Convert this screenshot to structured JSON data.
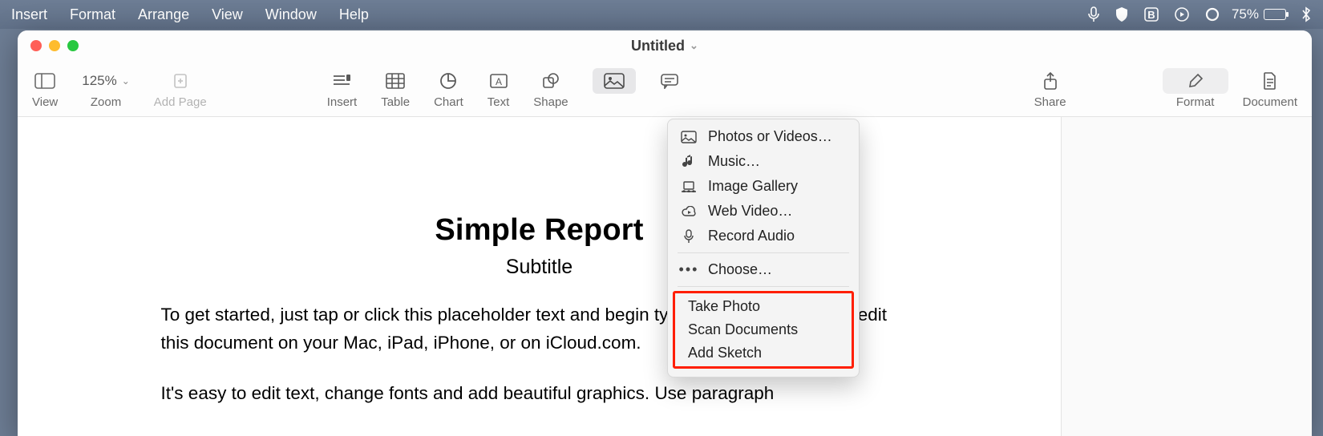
{
  "menubar": {
    "items": [
      "Insert",
      "Format",
      "Arrange",
      "View",
      "Window",
      "Help"
    ],
    "battery": "75%"
  },
  "window": {
    "title": "Untitled"
  },
  "toolbar": {
    "view": "View",
    "zoom_value": "125%",
    "zoom_label": "Zoom",
    "add_page": "Add Page",
    "insert": "Insert",
    "table": "Table",
    "chart": "Chart",
    "text": "Text",
    "shape": "Shape",
    "share": "Share",
    "format": "Format",
    "document": "Document"
  },
  "dropdown": {
    "photos": "Photos or Videos…",
    "music": "Music…",
    "gallery": "Image Gallery",
    "webvideo": "Web Video…",
    "record": "Record Audio",
    "choose": "Choose…",
    "take_photo": "Take Photo",
    "scan_docs": "Scan Documents",
    "add_sketch": "Add Sketch"
  },
  "doc": {
    "title": "Simple Report",
    "subtitle": "Subtitle",
    "p1": "To get started, just tap or click this placeholder text and begin typing. You can view and edit this document on your Mac, iPad, iPhone, or on iCloud.com.",
    "p2": "It's easy to edit text, change fonts and add beautiful graphics. Use paragraph"
  }
}
